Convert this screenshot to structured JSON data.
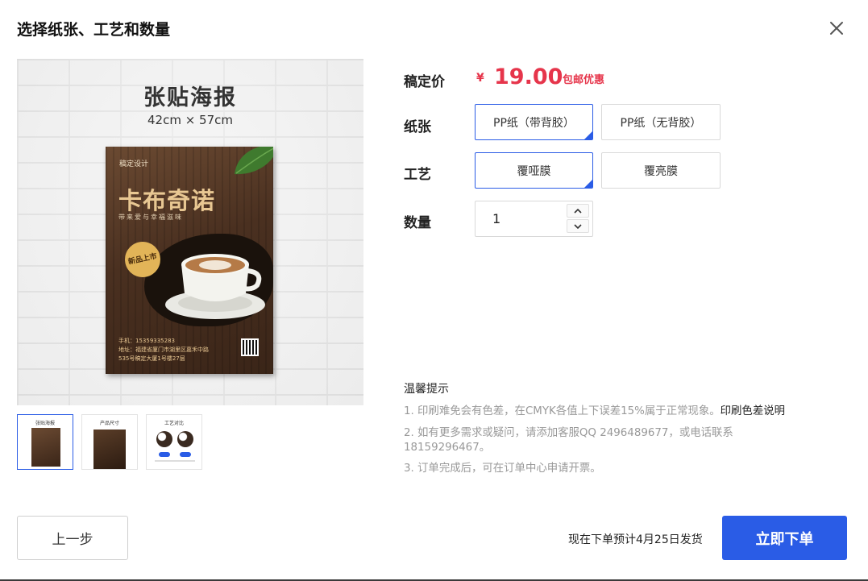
{
  "dialog": {
    "title": "选择纸张、工艺和数量",
    "close_icon": "close-icon"
  },
  "preview": {
    "heading": "张贴海报",
    "size": "42cm × 57cm",
    "zoom_icon": "zoom-in-icon",
    "poster": {
      "brand": "稿定设计",
      "title": "卡布奇诺",
      "slogan": "带来爱与幸福滋味",
      "badge": "新品上市",
      "phone": "手机：15359335283",
      "address_line1": "地址：福建省厦门市湖里区嘉禾中路",
      "address_line2": "535号稿定大厦1号楼27层"
    },
    "thumbnails": [
      {
        "caption": "张贴海报",
        "active": true
      },
      {
        "caption": "产品尺寸",
        "active": false
      },
      {
        "caption": "工艺对比",
        "active": false
      }
    ]
  },
  "order": {
    "price": {
      "label": "稿定价",
      "currency": "¥",
      "value": "19.00",
      "note": "包邮优惠"
    },
    "paper": {
      "label": "纸张",
      "options": [
        {
          "label": "PP纸（带背胶）",
          "selected": true
        },
        {
          "label": "PP纸（无背胶）",
          "selected": false
        }
      ]
    },
    "craft": {
      "label": "工艺",
      "options": [
        {
          "label": "覆哑膜",
          "selected": true
        },
        {
          "label": "覆亮膜",
          "selected": false
        }
      ]
    },
    "quantity": {
      "label": "数量",
      "value": "1"
    }
  },
  "tips": {
    "title": "温馨提示",
    "items": [
      {
        "text": "1. 印刷难免会有色差，在CMYK各值上下误差15%属于正常现象。",
        "link": "印刷色差说明"
      },
      {
        "text": "2. 如有更多需求或疑问，请添加客服QQ 2496489677，或电话联系 18159296467。"
      },
      {
        "text": "3. 订单完成后，可在订单中心申请开票。"
      }
    ]
  },
  "footer": {
    "prev_label": "上一步",
    "ship_note": "现在下单预计4月25日发货",
    "order_label": "立即下单"
  },
  "colors": {
    "accent": "#2a5ce6",
    "price": "#e6354b"
  }
}
